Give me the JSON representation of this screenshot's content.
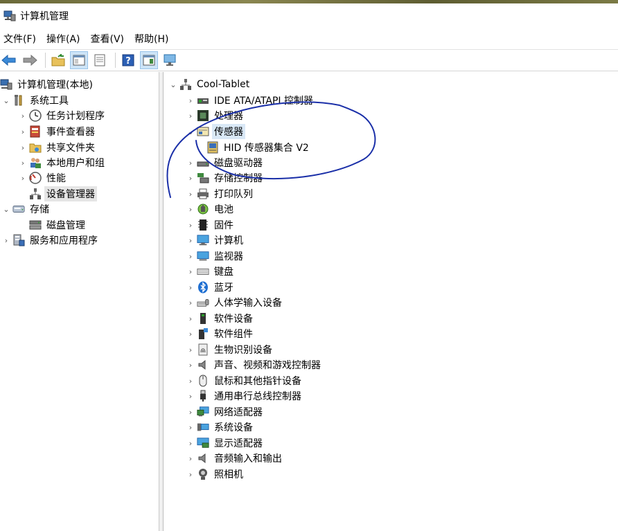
{
  "window": {
    "title": "计算机管理"
  },
  "menu": [
    "文件(F)",
    "操作(A)",
    "查看(V)",
    "帮助(H)"
  ],
  "toolbar": [
    "back-icon",
    "forward-icon",
    "up-folder-icon",
    "show-hide-tree-icon",
    "properties-icon",
    "help-icon",
    "action-pane-icon",
    "monitor-icon"
  ],
  "left_tree": {
    "root": "计算机管理(本地)",
    "system_tools": "系统工具",
    "task_scheduler": "任务计划程序",
    "event_viewer": "事件查看器",
    "shared_folders": "共享文件夹",
    "local_users": "本地用户和组",
    "performance": "性能",
    "device_manager": "设备管理器",
    "storage": "存储",
    "disk_management": "磁盘管理",
    "services_apps": "服务和应用程序"
  },
  "device_tree": {
    "computer": "Cool-Tablet",
    "ide": "IDE ATA/ATAPI 控制器",
    "processors": "处理器",
    "sensors": "传感器",
    "hid_sensor": "HID 传感器集合 V2",
    "disk_drives": "磁盘驱动器",
    "storage_controllers": "存储控制器",
    "print_queues": "打印队列",
    "batteries": "电池",
    "firmware": "固件",
    "computer_cat": "计算机",
    "monitors": "监视器",
    "keyboards": "键盘",
    "bluetooth": "蓝牙",
    "hid": "人体学输入设备",
    "software_devices": "软件设备",
    "software_components": "软件组件",
    "biometric": "生物识别设备",
    "sound": "声音、视频和游戏控制器",
    "mice": "鼠标和其他指针设备",
    "usb": "通用串行总线控制器",
    "network": "网络适配器",
    "system_devices": "系统设备",
    "display": "显示适配器",
    "audio_io": "音频输入和输出",
    "cameras": "照相机"
  },
  "colors": {
    "selection": "#e5e5e5",
    "highlight": "#d9e8f6",
    "annotation_ink": "#1a2fa8"
  }
}
